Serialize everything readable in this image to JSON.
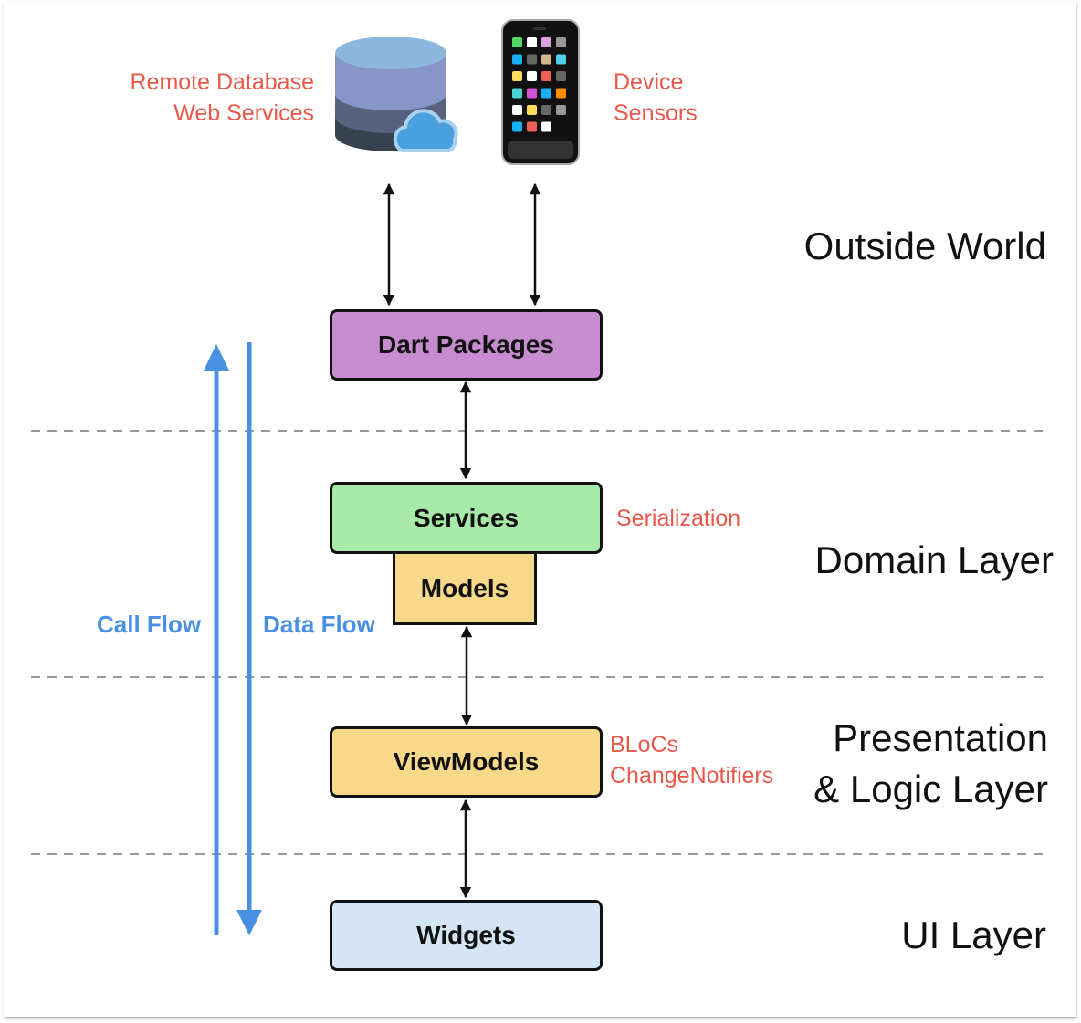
{
  "diagram": {
    "sources": {
      "remote": {
        "line1": "Remote Database",
        "line2": "Web Services",
        "icon": "database-cloud-icon"
      },
      "device": {
        "line1": "Device",
        "line2": "Sensors",
        "icon": "smartphone-icon"
      }
    },
    "boxes": {
      "dart_packages": {
        "label": "Dart Packages",
        "color": "#c78bcf"
      },
      "services": {
        "label": "Services",
        "color": "#a8eaa8"
      },
      "models": {
        "label": "Models",
        "color": "#f8d98a"
      },
      "viewmodels": {
        "label": "ViewModels",
        "color": "#f8d98a"
      },
      "widgets": {
        "label": "Widgets",
        "color": "#d4e5f6"
      }
    },
    "annotations": {
      "serialization": "Serialization",
      "blocs": "BLoCs",
      "change_notifiers": "ChangeNotifiers"
    },
    "layers": {
      "outside_world": "Outside World",
      "domain": "Domain Layer",
      "presentation_line1": "Presentation",
      "presentation_line2": "& Logic Layer",
      "ui": "UI Layer"
    },
    "flows": {
      "call_flow": "Call Flow",
      "data_flow": "Data Flow",
      "color": "#4a90e2"
    },
    "colors": {
      "annotation": "#e8584a",
      "divider": "#999999"
    }
  }
}
